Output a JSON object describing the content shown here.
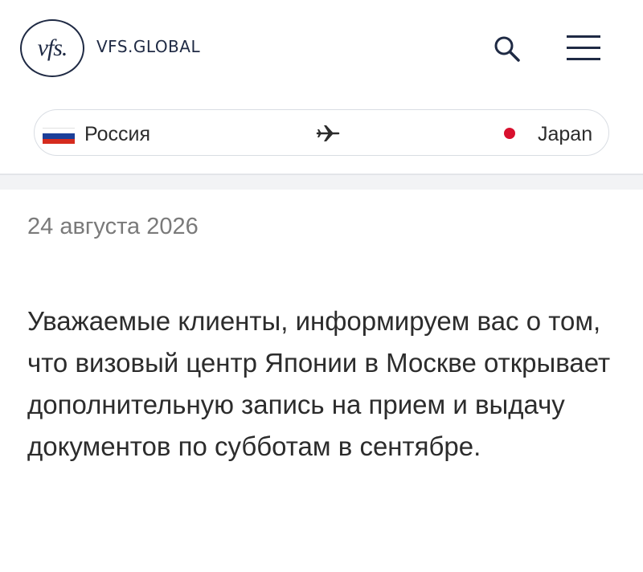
{
  "header": {
    "logo_text": "vfs.",
    "brand": "VFS.GLOBAL",
    "search_icon": "search-icon",
    "menu_icon": "hamburger-menu-icon"
  },
  "route": {
    "from_label": "Россия",
    "from_flag": "russia-flag-icon",
    "arrow_icon": "airplane-icon",
    "to_label": "Japan",
    "to_flag": "japan-flag-icon",
    "colors": {
      "ru_white": "#ffffff",
      "ru_blue": "#1c3f99",
      "ru_red": "#d52b1e",
      "jp_red": "#d8102e"
    }
  },
  "article": {
    "date": "24 августа 2026",
    "body": "Уважаемые клиенты, информируем вас о том, что визовый центр Японии в Москве открывает дополнительную запись на прием и выдачу документов по субботам в сентябре."
  }
}
